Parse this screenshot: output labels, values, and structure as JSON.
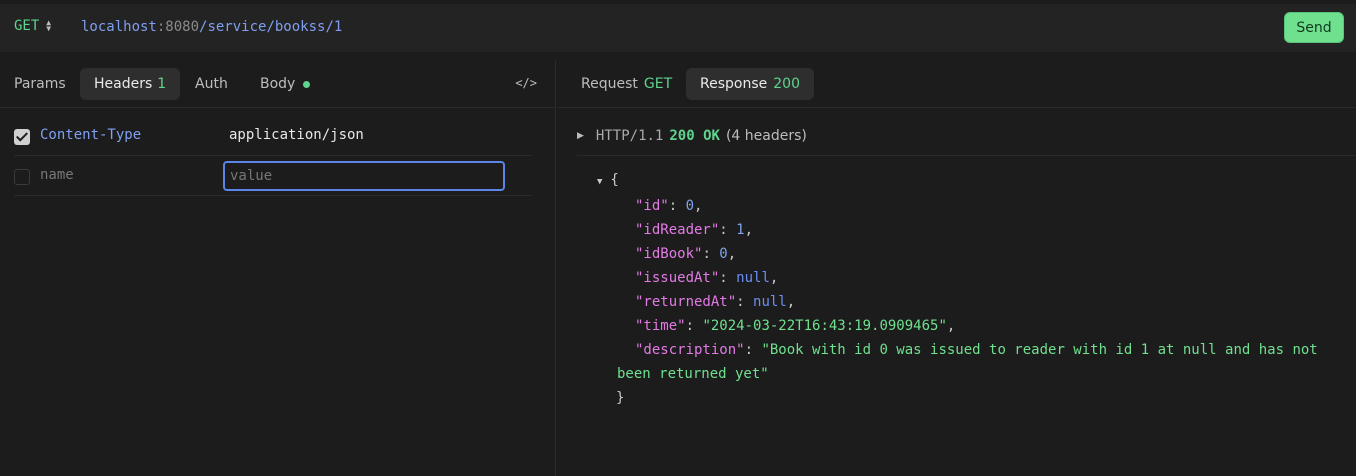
{
  "request": {
    "method": "GET",
    "url_host": "localhost",
    "url_colon": ":",
    "url_port": "8080",
    "url_path": "/service/bookss/1",
    "send_label": "Send"
  },
  "left_tabs": {
    "params": "Params",
    "headers": "Headers",
    "headers_count": "1",
    "auth": "Auth",
    "body": "Body",
    "code_icon": "</>"
  },
  "headers": [
    {
      "enabled": true,
      "name": "Content-Type",
      "value": "application/json"
    }
  ],
  "new_header": {
    "name_placeholder": "name",
    "value_placeholder": "value"
  },
  "right_tabs": {
    "request": "Request",
    "request_method": "GET",
    "response": "Response",
    "response_status": "200"
  },
  "response": {
    "protocol": "HTTP/1.1",
    "status": "200 OK",
    "header_count": "(4 headers)",
    "json_open": "{",
    "json_close": "}",
    "fields": {
      "id": {
        "key": "\"id\"",
        "value": "0"
      },
      "idReader": {
        "key": "\"idReader\"",
        "value": "1"
      },
      "idBook": {
        "key": "\"idBook\"",
        "value": "0"
      },
      "issuedAt": {
        "key": "\"issuedAt\"",
        "value": "null"
      },
      "returnedAt": {
        "key": "\"returnedAt\"",
        "value": "null"
      },
      "time": {
        "key": "\"time\"",
        "value": "\"2024-03-22T16:43:19.0909465\""
      },
      "description": {
        "key": "\"description\"",
        "value": "\"Book with id 0 was issued to reader with id 1 at null and has not been returned yet\""
      }
    }
  },
  "colors": {
    "accent_green": "#5fd38d",
    "link_blue": "#7f9ff0",
    "json_key": "#e37ae6",
    "json_string": "#6fe08e",
    "background": "#1c1c1c"
  }
}
